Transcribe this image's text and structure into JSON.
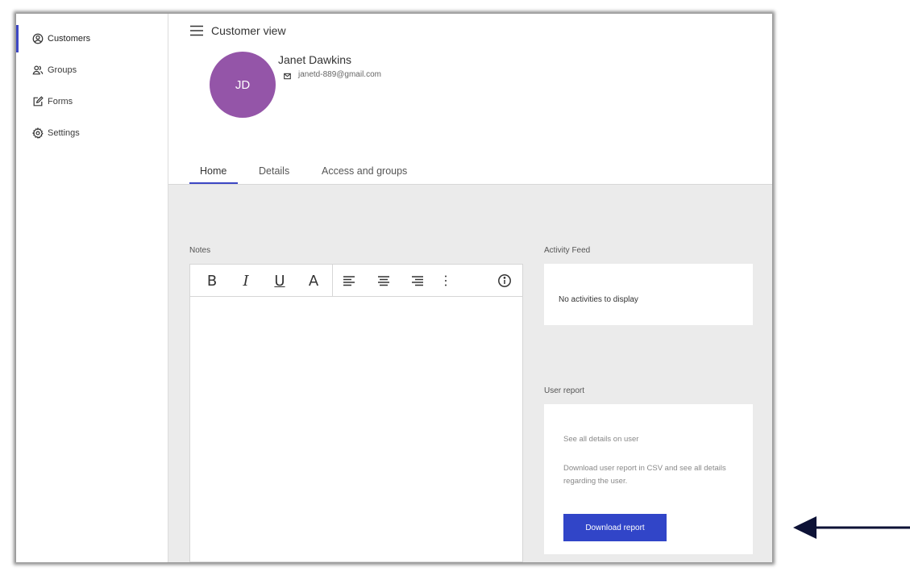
{
  "sidebar": {
    "items": [
      {
        "label": "Customers",
        "icon": "account-circle-icon",
        "active": true
      },
      {
        "label": "Groups",
        "icon": "groups-icon"
      },
      {
        "label": "Forms",
        "icon": "edit-form-icon"
      },
      {
        "label": "Settings",
        "icon": "gear-icon"
      }
    ]
  },
  "header": {
    "title": "Customer view",
    "menu_icon": "hamburger-menu-icon"
  },
  "user": {
    "initials": "JD",
    "name": "Janet Dawkins",
    "email": "janetd-889@gmail.com",
    "avatar_color": "#9455a8"
  },
  "tabs": [
    {
      "label": "Home",
      "active": true
    },
    {
      "label": "Details"
    },
    {
      "label": "Access and groups"
    }
  ],
  "notes": {
    "label": "Notes",
    "toolbar": {
      "bold": "B",
      "italic": "I",
      "underline": "U",
      "font_color": "A"
    }
  },
  "activity": {
    "label": "Activity Feed",
    "empty_text": "No activities to display"
  },
  "report": {
    "label": "User report",
    "text1": "See all details on user",
    "text2": "Download user report in CSV and see all details regarding the user.",
    "button_label": "Download report"
  },
  "colors": {
    "accent": "#3d47c4",
    "button": "#3145c8",
    "arrow": "#0d1236"
  }
}
